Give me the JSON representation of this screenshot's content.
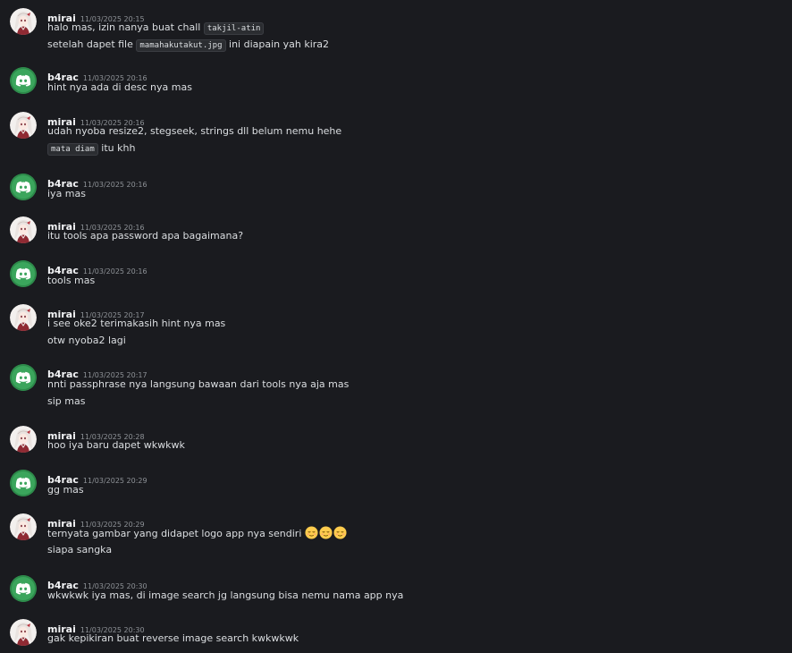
{
  "messages": [
    {
      "id": "m1",
      "author": "mirai",
      "avatar": "anime-girl-avatar-icon",
      "timestamp": "11/03/2025 20:15",
      "lines": [
        {
          "text": "halo mas, izin nanya buat chall ",
          "code": "takjil-atin",
          "after": ""
        },
        {
          "text": "setelah dapet file ",
          "code": "mamahakutakut.jpg",
          "after": " ini diapain yah kira2"
        }
      ]
    },
    {
      "id": "m2",
      "author": "b4rac",
      "avatar": "discord-logo-avatar-icon",
      "timestamp": "11/03/2025 20:16",
      "lines": [
        {
          "text": "hint nya ada di desc nya mas"
        }
      ]
    },
    {
      "id": "m3",
      "author": "mirai",
      "avatar": "anime-girl-avatar-icon",
      "timestamp": "11/03/2025 20:16",
      "lines": [
        {
          "text": "udah nyoba resize2, stegseek, strings dll belum nemu hehe"
        },
        {
          "text": "",
          "code": "mata diam",
          "after": " itu khh"
        }
      ]
    },
    {
      "id": "m4",
      "author": "b4rac",
      "avatar": "discord-logo-avatar-icon",
      "timestamp": "11/03/2025 20:16",
      "lines": [
        {
          "text": "iya mas"
        }
      ]
    },
    {
      "id": "m5",
      "author": "mirai",
      "avatar": "anime-girl-avatar-icon",
      "timestamp": "11/03/2025 20:16",
      "lines": [
        {
          "text": "itu tools apa password apa bagaimana?"
        }
      ]
    },
    {
      "id": "m6",
      "author": "b4rac",
      "avatar": "discord-logo-avatar-icon",
      "timestamp": "11/03/2025 20:16",
      "lines": [
        {
          "text": "tools mas"
        }
      ]
    },
    {
      "id": "m7",
      "author": "mirai",
      "avatar": "anime-girl-avatar-icon",
      "timestamp": "11/03/2025 20:17",
      "lines": [
        {
          "text": "i see oke2 terimakasih hint nya mas"
        },
        {
          "text": "otw nyoba2 lagi"
        }
      ]
    },
    {
      "id": "m8",
      "author": "b4rac",
      "avatar": "discord-logo-avatar-icon",
      "timestamp": "11/03/2025 20:17",
      "lines": [
        {
          "text": "nnti passphrase nya langsung bawaan dari tools nya aja mas"
        },
        {
          "text": "sip mas"
        }
      ]
    },
    {
      "id": "m9",
      "author": "mirai",
      "avatar": "anime-girl-avatar-icon",
      "timestamp": "11/03/2025 20:28",
      "lines": [
        {
          "text": "hoo iya baru dapet wkwkwk"
        }
      ]
    },
    {
      "id": "m10",
      "author": "b4rac",
      "avatar": "discord-logo-avatar-icon",
      "timestamp": "11/03/2025 20:29",
      "lines": [
        {
          "text": "gg mas"
        }
      ]
    },
    {
      "id": "m11",
      "author": "mirai",
      "avatar": "anime-girl-avatar-icon",
      "timestamp": "11/03/2025 20:29",
      "lines": [
        {
          "text": "ternyata gambar yang didapet logo app nya sendiri ",
          "emoji": [
            "relieved-face-icon",
            "relieved-face-icon",
            "relieved-face-icon"
          ]
        },
        {
          "text": "siapa sangka"
        }
      ]
    },
    {
      "id": "m12",
      "author": "b4rac",
      "avatar": "discord-logo-avatar-icon",
      "timestamp": "11/03/2025 20:30",
      "lines": [
        {
          "text": "wkwkwk iya mas, di image search jg langsung bisa nemu nama app nya"
        }
      ]
    },
    {
      "id": "m13",
      "author": "mirai",
      "avatar": "anime-girl-avatar-icon",
      "timestamp": "11/03/2025 20:30",
      "lines": [
        {
          "text": "gak kepikiran buat reverse image search kwkwkwk"
        }
      ]
    }
  ],
  "colors": {
    "background": "#1a1b1f",
    "text": "#dbdee1",
    "username": "#f2f3f5",
    "timestamp": "#8e9297",
    "discord_avatar_bg": "#3ba55c",
    "code_bg": "#2b2d31"
  }
}
